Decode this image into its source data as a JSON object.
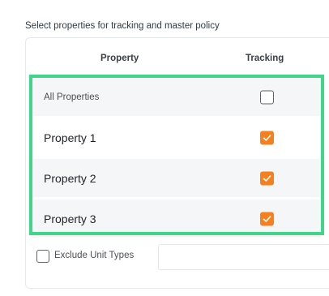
{
  "panel": {
    "title": "Select properties for tracking and master policy"
  },
  "table": {
    "columns": [
      "Property",
      "Tracking"
    ],
    "rows": [
      {
        "label": "All Properties",
        "tracking": false
      },
      {
        "label": "Property 1",
        "tracking": true
      },
      {
        "label": "Property 2",
        "tracking": true
      },
      {
        "label": "Property 3",
        "tracking": true
      }
    ]
  },
  "exclude": {
    "label": "Exclude Unit Types",
    "checked": false
  },
  "colors": {
    "checkbox_checked": "#f4801f",
    "highlight_border": "#3fd68a",
    "row_shade": "#f5f6f8"
  }
}
